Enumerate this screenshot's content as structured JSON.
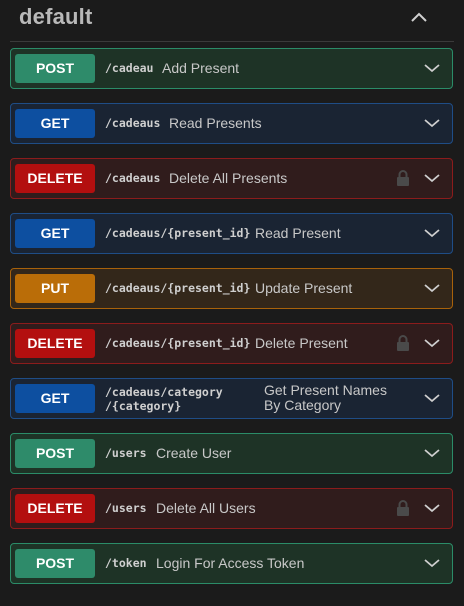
{
  "section": {
    "title": "default"
  },
  "operations": [
    {
      "method": "POST",
      "path": "/cadeau",
      "summary": "Add Present"
    },
    {
      "method": "GET",
      "path": "/cadeaus",
      "summary": "Read Presents"
    },
    {
      "method": "DELETE",
      "path": "/cadeaus",
      "summary": "Delete All Presents"
    },
    {
      "method": "GET",
      "path": "/cadeaus/{present_id}",
      "summary": "Read Present"
    },
    {
      "method": "PUT",
      "path": "/cadeaus/{present_id}",
      "summary": "Update Present"
    },
    {
      "method": "DELETE",
      "path": "/cadeaus/{present_id}",
      "summary": "Delete Present"
    },
    {
      "method": "GET",
      "path": "/cadeaus/category /{category}",
      "summary": "Get Present Names By Category"
    },
    {
      "method": "POST",
      "path": "/users",
      "summary": "Create User"
    },
    {
      "method": "DELETE",
      "path": "/users",
      "summary": "Delete All Users"
    },
    {
      "method": "POST",
      "path": "/token",
      "summary": "Login For Access Token"
    }
  ],
  "colors": {
    "post": "#2e8b6a",
    "get": "#0d4fa0",
    "delete": "#b30f0f",
    "put": "#ba6d08",
    "background": "#1b1b1b"
  },
  "icons": {
    "expand": "chevron-down-icon",
    "collapse": "chevron-up-icon",
    "lock": "lock-icon"
  }
}
